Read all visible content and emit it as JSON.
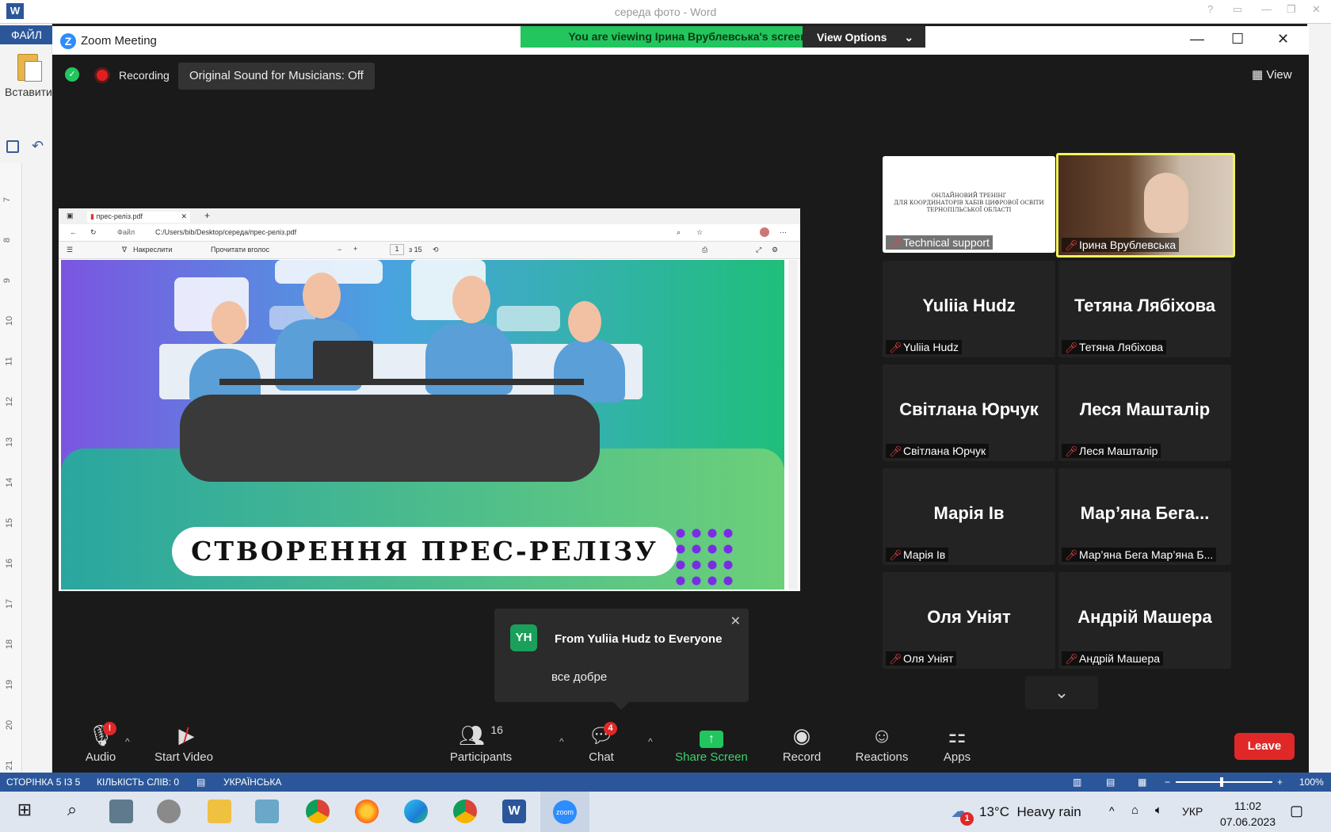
{
  "word": {
    "title": "середа фото - Word",
    "file_tab": "ФАЙЛ",
    "paste_label": "Вставити",
    "ruler_numbers": [
      "7",
      "8",
      "9",
      "10",
      "11",
      "12",
      "13",
      "14",
      "15",
      "16",
      "17",
      "18",
      "19",
      "20",
      "21"
    ],
    "status": {
      "page": "СТОРІНКА 5 ІЗ 5",
      "words": "КІЛЬКІСТЬ СЛІВ: 0",
      "language": "УКРАЇНСЬКА",
      "zoom": "100%"
    }
  },
  "zoom": {
    "title": "Zoom Meeting",
    "banner": "You are viewing Ірина Врублевська's screen",
    "view_options": "View Options",
    "recording": "Recording",
    "original_sound": "Original Sound for Musicians: Off",
    "view_label": "View",
    "shared_screen": {
      "tab_title": "прес-реліз.pdf",
      "address_prefix": "Файл",
      "address": "C:/Users/bib/Desktop/середа/прес-реліз.pdf",
      "draw_label": "Накреслити",
      "read_aloud": "Прочитати вголос",
      "page_num": "1",
      "page_total": "з 15",
      "slide_title": "СТВОРЕННЯ ПРЕС-РЕЛІЗУ"
    },
    "tech_tile": {
      "line1": "ОНЛАЙНОВИЙ ТРЕНІНГ",
      "line2": "ДЛЯ КООРДИНАТОРІВ ХАБІВ ЦИФРОВОЇ ОСВІТИ",
      "line3": "ТЕРНОПІЛЬСЬКОЇ ОБЛАСТІ",
      "label": "Technical support"
    },
    "iryna_tile": {
      "label": "Ірина Врублевська"
    },
    "participants": [
      {
        "big": "Yuliia Hudz",
        "label": "Yuliia Hudz"
      },
      {
        "big": "Тетяна Лябіхова",
        "label": "Тетяна Лябіхова"
      },
      {
        "big": "Світлана Юрчук",
        "label": "Світлана Юрчук"
      },
      {
        "big": "Леся Машталір",
        "label": "Леся Машталір"
      },
      {
        "big": "Марія Ів",
        "label": "Марія Ів"
      },
      {
        "big": "Мар’яна Бега...",
        "label": "Мар’яна Бега Мар’яна Б..."
      },
      {
        "big": "Оля Уніят",
        "label": "Оля Уніят"
      },
      {
        "big": "Андрій Машера",
        "label": "Андрій Машера"
      }
    ],
    "chat_popup": {
      "avatar": "YH",
      "from": "From Yuliia Hudz to Everyone",
      "message": "все добре"
    },
    "toolbar": {
      "audio": "Audio",
      "audio_badge": "!",
      "start_video": "Start Video",
      "participants": "Participants",
      "participants_count": "16",
      "chat": "Chat",
      "chat_badge": "4",
      "share_screen": "Share Screen",
      "record": "Record",
      "reactions": "Reactions",
      "apps": "Apps",
      "leave": "Leave"
    }
  },
  "taskbar": {
    "weather_temp": "13°C",
    "weather_desc": "Heavy rain",
    "weather_badge": "1",
    "language": "УКР",
    "time": "11:02",
    "date": "07.06.2023"
  },
  "colors": {
    "zoom_green": "#22c55e",
    "leave_red": "#e02828",
    "word_blue": "#2b579a",
    "active_speaker": "#f1f55a"
  }
}
